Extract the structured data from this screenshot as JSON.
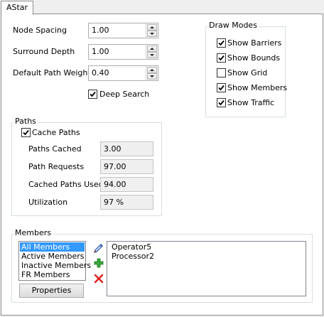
{
  "tab": {
    "label": "AStar"
  },
  "fields": {
    "node_spacing": {
      "label": "Node Spacing",
      "value": "1.00"
    },
    "surround_depth": {
      "label": "Surround Depth",
      "value": "1.00"
    },
    "default_path_weight": {
      "label": "Default Path Weight",
      "value": "0.40"
    }
  },
  "deep_search": {
    "label": "Deep Search",
    "checked": true
  },
  "draw_modes": {
    "title": "Draw Modes",
    "items": [
      {
        "label": "Show Barriers",
        "checked": true
      },
      {
        "label": "Show Bounds",
        "checked": true
      },
      {
        "label": "Show Grid",
        "checked": false
      },
      {
        "label": "Show Members",
        "checked": true
      },
      {
        "label": "Show Traffic",
        "checked": true
      }
    ]
  },
  "paths": {
    "title": "Paths",
    "cache_paths": {
      "label": "Cache Paths",
      "checked": true
    },
    "stats": [
      {
        "label": "Paths Cached",
        "value": "3.00"
      },
      {
        "label": "Path Requests",
        "value": "97.00"
      },
      {
        "label": "Cached Paths Used",
        "value": "94.00"
      },
      {
        "label": "Utilization",
        "value": "97 %"
      }
    ]
  },
  "members": {
    "title": "Members",
    "categories": [
      "All Members",
      "Active Members",
      "Inactive Members",
      "FR Members"
    ],
    "selected_index": 0,
    "properties_label": "Properties",
    "entries": [
      "Operator5",
      "Processor2"
    ],
    "icons": [
      "eyedropper-icon",
      "add-icon",
      "delete-icon"
    ],
    "colors": {
      "selection": "#3399ff",
      "add": "#3aa53a",
      "delete": "#e02020",
      "eyedropper": "#2f5fb3"
    }
  }
}
